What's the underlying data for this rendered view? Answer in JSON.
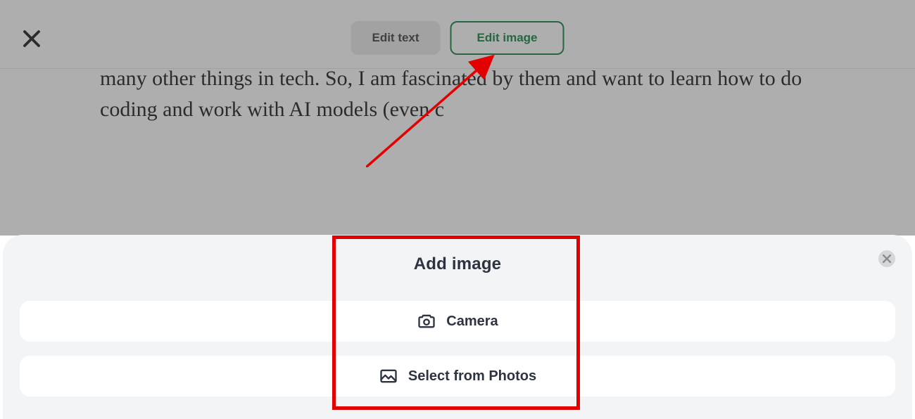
{
  "topbar": {
    "edit_text_label": "Edit text",
    "edit_image_label": "Edit image"
  },
  "body_text": "many other things in tech. So, I am  fascinated by them and want to learn how to do coding and work with AI  models (even c",
  "sheet": {
    "title": "Add image",
    "camera_label": "Camera",
    "photos_label": "Select from Photos"
  }
}
